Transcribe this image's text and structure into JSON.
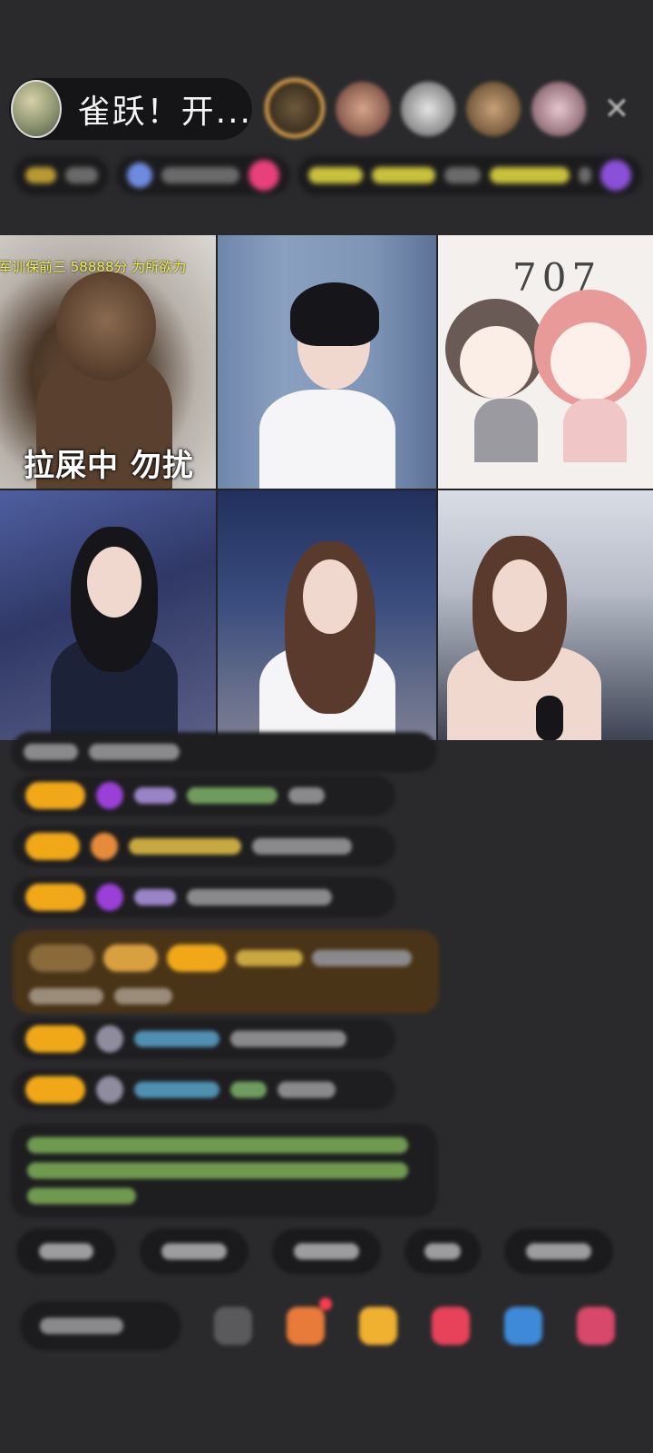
{
  "header": {
    "host_name": "雀跃！开...",
    "close_icon": "close-icon"
  },
  "video_grid": {
    "tile_0": {
      "ticker": "军训保前三 58888分 为所欲为",
      "caption": "拉屎中 勿扰"
    },
    "tile_2": {
      "art_title": "707"
    }
  },
  "colors": {
    "background": "#2a2a2c",
    "level_badge": "#f0a818",
    "ticker_text": "#f2ee55",
    "highlight_bubble": "#4a3418"
  }
}
